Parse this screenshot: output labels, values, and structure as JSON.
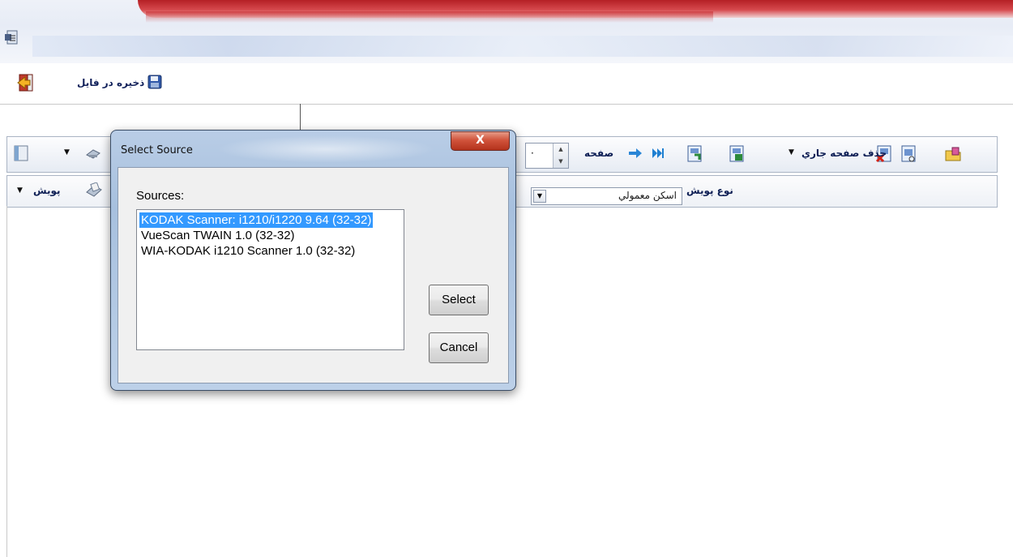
{
  "header": {
    "save_label": "ذخيره در فايل"
  },
  "toolbar": {
    "delete_page_label": "حذف صفحه جاري",
    "page_label": "صفحه",
    "page_value": "·",
    "scan_type_label": "نوع پويش",
    "scan_type_value": "اسکن معمولي",
    "scan_button_label": "پويش"
  },
  "dialog": {
    "title": "Select Source",
    "close_glyph": "X",
    "sources_label": "Sources:",
    "sources": [
      "KODAK Scanner: i1210/i1220 9.64 (32-32)",
      "VueScan TWAIN 1.0 (32-32)",
      "WIA-KODAK i1210 Scanner 1.0 (32-32)"
    ],
    "selected_index": 0,
    "select_button": "Select",
    "cancel_button": "Cancel"
  },
  "colors": {
    "selection": "#3399ff",
    "title_bar_red": "#c3282d",
    "dialog_frame": "#b9cde6",
    "close_button": "#c94630"
  }
}
